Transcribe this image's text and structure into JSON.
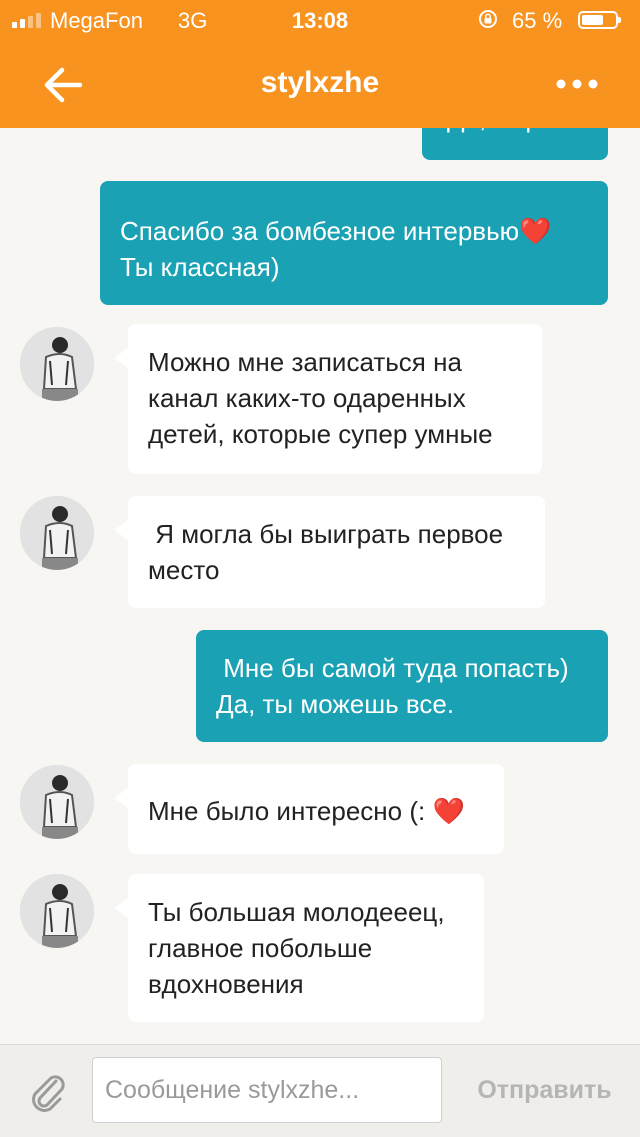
{
  "status_bar": {
    "carrier": "MegaFon",
    "network": "3G",
    "time": "13:08",
    "battery_percent": "65 %",
    "battery_level": 0.65,
    "icons": [
      "signal-icon",
      "rotation-lock-icon",
      "battery-icon"
    ]
  },
  "header": {
    "title": "stylxzhe",
    "back_icon": "arrow-left-icon",
    "more_icon": "more-dots-icon"
  },
  "messages": [
    {
      "direction": "outgoing",
      "lines": [
        "Да, Верлин"
      ]
    },
    {
      "direction": "outgoing",
      "lines": [
        "Спасибо за бомбезное интервью❤️",
        "Ты классная)"
      ]
    },
    {
      "direction": "incoming",
      "lines": [
        "Можно мне записаться на",
        "канал каких-то одаренных",
        "детей, которые супер умные"
      ]
    },
    {
      "direction": "incoming",
      "lines": [
        " Я могла бы выиграть первое",
        "место"
      ]
    },
    {
      "direction": "outgoing",
      "lines": [
        " Мне бы самой туда попасть)",
        "Да, ты можешь все."
      ]
    },
    {
      "direction": "incoming",
      "lines": [
        "Мне было интересно (: ❤️"
      ]
    },
    {
      "direction": "incoming",
      "lines": [
        "Ты большая молодееец,",
        "главное побольше",
        "вдохновения"
      ]
    }
  ],
  "input_bar": {
    "placeholder": "Сообщение stylxzhe...",
    "value": "",
    "send_label": "Отправить",
    "attach_icon": "paperclip-icon"
  },
  "colors": {
    "header": "#f7931e",
    "outgoing_bubble": "#1aa1b4",
    "incoming_bubble": "#ffffff",
    "background": "#f8f6f3"
  }
}
